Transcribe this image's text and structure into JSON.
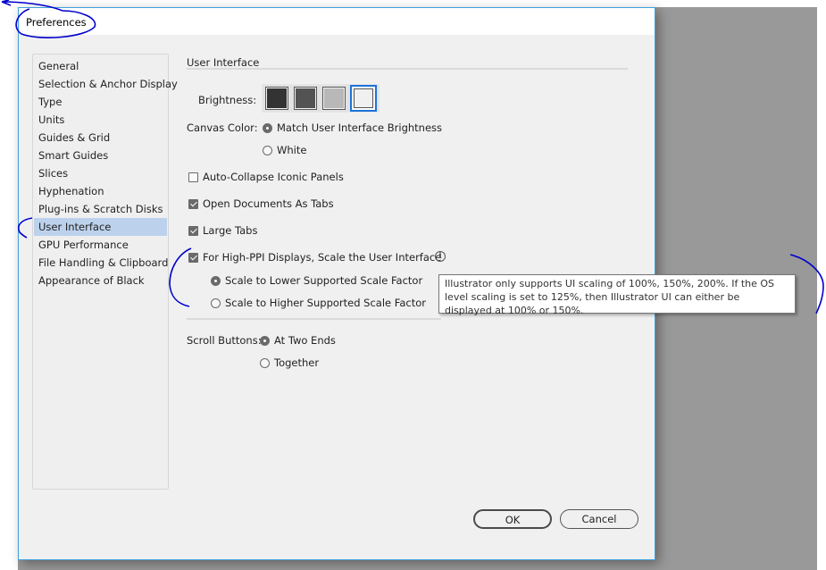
{
  "window": {
    "title": "Preferences"
  },
  "sidebar": {
    "selected_index": 9,
    "items": [
      {
        "label": "General"
      },
      {
        "label": "Selection & Anchor Display"
      },
      {
        "label": "Type"
      },
      {
        "label": "Units"
      },
      {
        "label": "Guides & Grid"
      },
      {
        "label": "Smart Guides"
      },
      {
        "label": "Slices"
      },
      {
        "label": "Hyphenation"
      },
      {
        "label": "Plug-ins & Scratch Disks"
      },
      {
        "label": "User Interface"
      },
      {
        "label": "GPU Performance"
      },
      {
        "label": "File Handling & Clipboard"
      },
      {
        "label": "Appearance of Black"
      }
    ]
  },
  "panel": {
    "section_title": "User Interface",
    "brightness": {
      "label": "Brightness:",
      "selected_index": 3,
      "swatches": [
        {
          "name": "dark",
          "color": "#333333"
        },
        {
          "name": "medium-dark",
          "color": "#535353"
        },
        {
          "name": "medium-light",
          "color": "#b8b8b8"
        },
        {
          "name": "light",
          "color": "#f0f0f0"
        }
      ]
    },
    "canvas_color": {
      "label": "Canvas Color:",
      "options": [
        {
          "label": "Match User Interface Brightness",
          "selected": true
        },
        {
          "label": "White",
          "selected": false
        }
      ]
    },
    "checkboxes": [
      {
        "label": "Auto-Collapse Iconic Panels",
        "checked": false
      },
      {
        "label": "Open Documents As Tabs",
        "checked": true
      },
      {
        "label": "Large Tabs",
        "checked": true
      },
      {
        "label": "For High-PPI Displays, Scale the User Interface",
        "checked": true
      }
    ],
    "scale_options": [
      {
        "label": "Scale to Lower Supported Scale Factor",
        "selected": true
      },
      {
        "label": "Scale to Higher Supported Scale Factor",
        "selected": false
      }
    ],
    "tooltip": "Illustrator only supports UI scaling of 100%, 150%, 200%. If the OS level scaling is set to 125%, then Illustrator UI can either be displayed at 100% or 150%.",
    "scroll_buttons": {
      "label": "Scroll Buttons:",
      "options": [
        {
          "label": "At Two Ends",
          "selected": true
        },
        {
          "label": "Together",
          "selected": false
        }
      ]
    }
  },
  "buttons": {
    "ok": "OK",
    "cancel": "Cancel"
  },
  "colors": {
    "accent": "#3fa0e0",
    "selection": "#bcd2ec",
    "annotation": "#0000cc"
  }
}
